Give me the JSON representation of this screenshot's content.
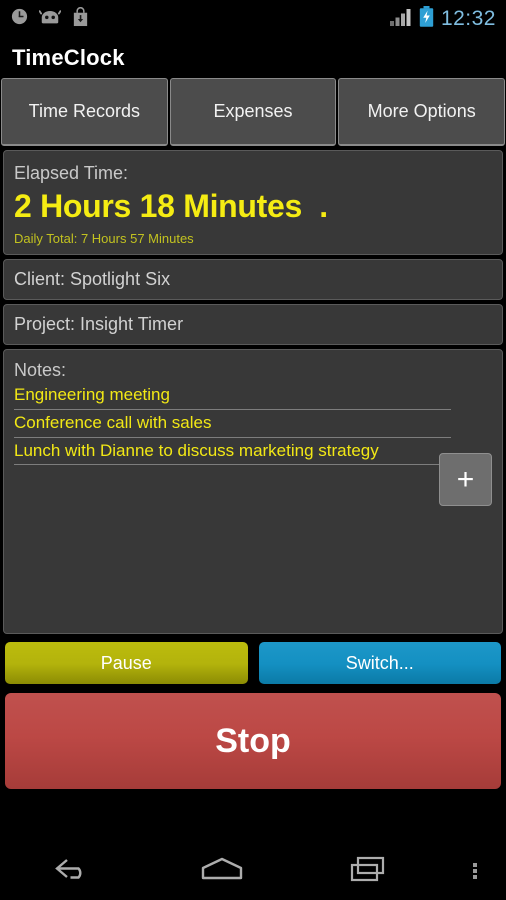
{
  "status_bar": {
    "icons_left": [
      "clock-icon",
      "android-icon",
      "play-store-download-icon"
    ],
    "icons_right": [
      "signal-icon",
      "battery-charging-icon"
    ],
    "time": "12:32",
    "time_color": "#7fbde0"
  },
  "action_bar": {
    "title": "TimeClock"
  },
  "tabs": [
    {
      "label": "Time Records"
    },
    {
      "label": "Expenses"
    },
    {
      "label": "More Options"
    }
  ],
  "elapsed": {
    "label": "Elapsed Time:",
    "value": "2 Hours 18 Minutes  .",
    "daily_total": "Daily Total: 7 Hours 57 Minutes",
    "value_color": "#f5ec13",
    "total_color": "#c2c220"
  },
  "info": {
    "client": "Client: Spotlight Six",
    "project": "Project: Insight Timer"
  },
  "notes": {
    "label": "Notes:",
    "items": [
      "Engineering meeting",
      "Conference call with sales",
      "Lunch with Dianne to discuss marketing strategy"
    ],
    "add_button": "+",
    "text_color": "#f2e815"
  },
  "actions": {
    "pause": "Pause",
    "switch": "Switch...",
    "stop": "Stop",
    "pause_color": "#b3b30c",
    "switch_color": "#1490c2",
    "stop_color": "#bc4845"
  },
  "nav_bar": {
    "back": "back-icon",
    "home": "home-icon",
    "recents": "recents-icon",
    "overflow": "overflow-menu-icon"
  }
}
